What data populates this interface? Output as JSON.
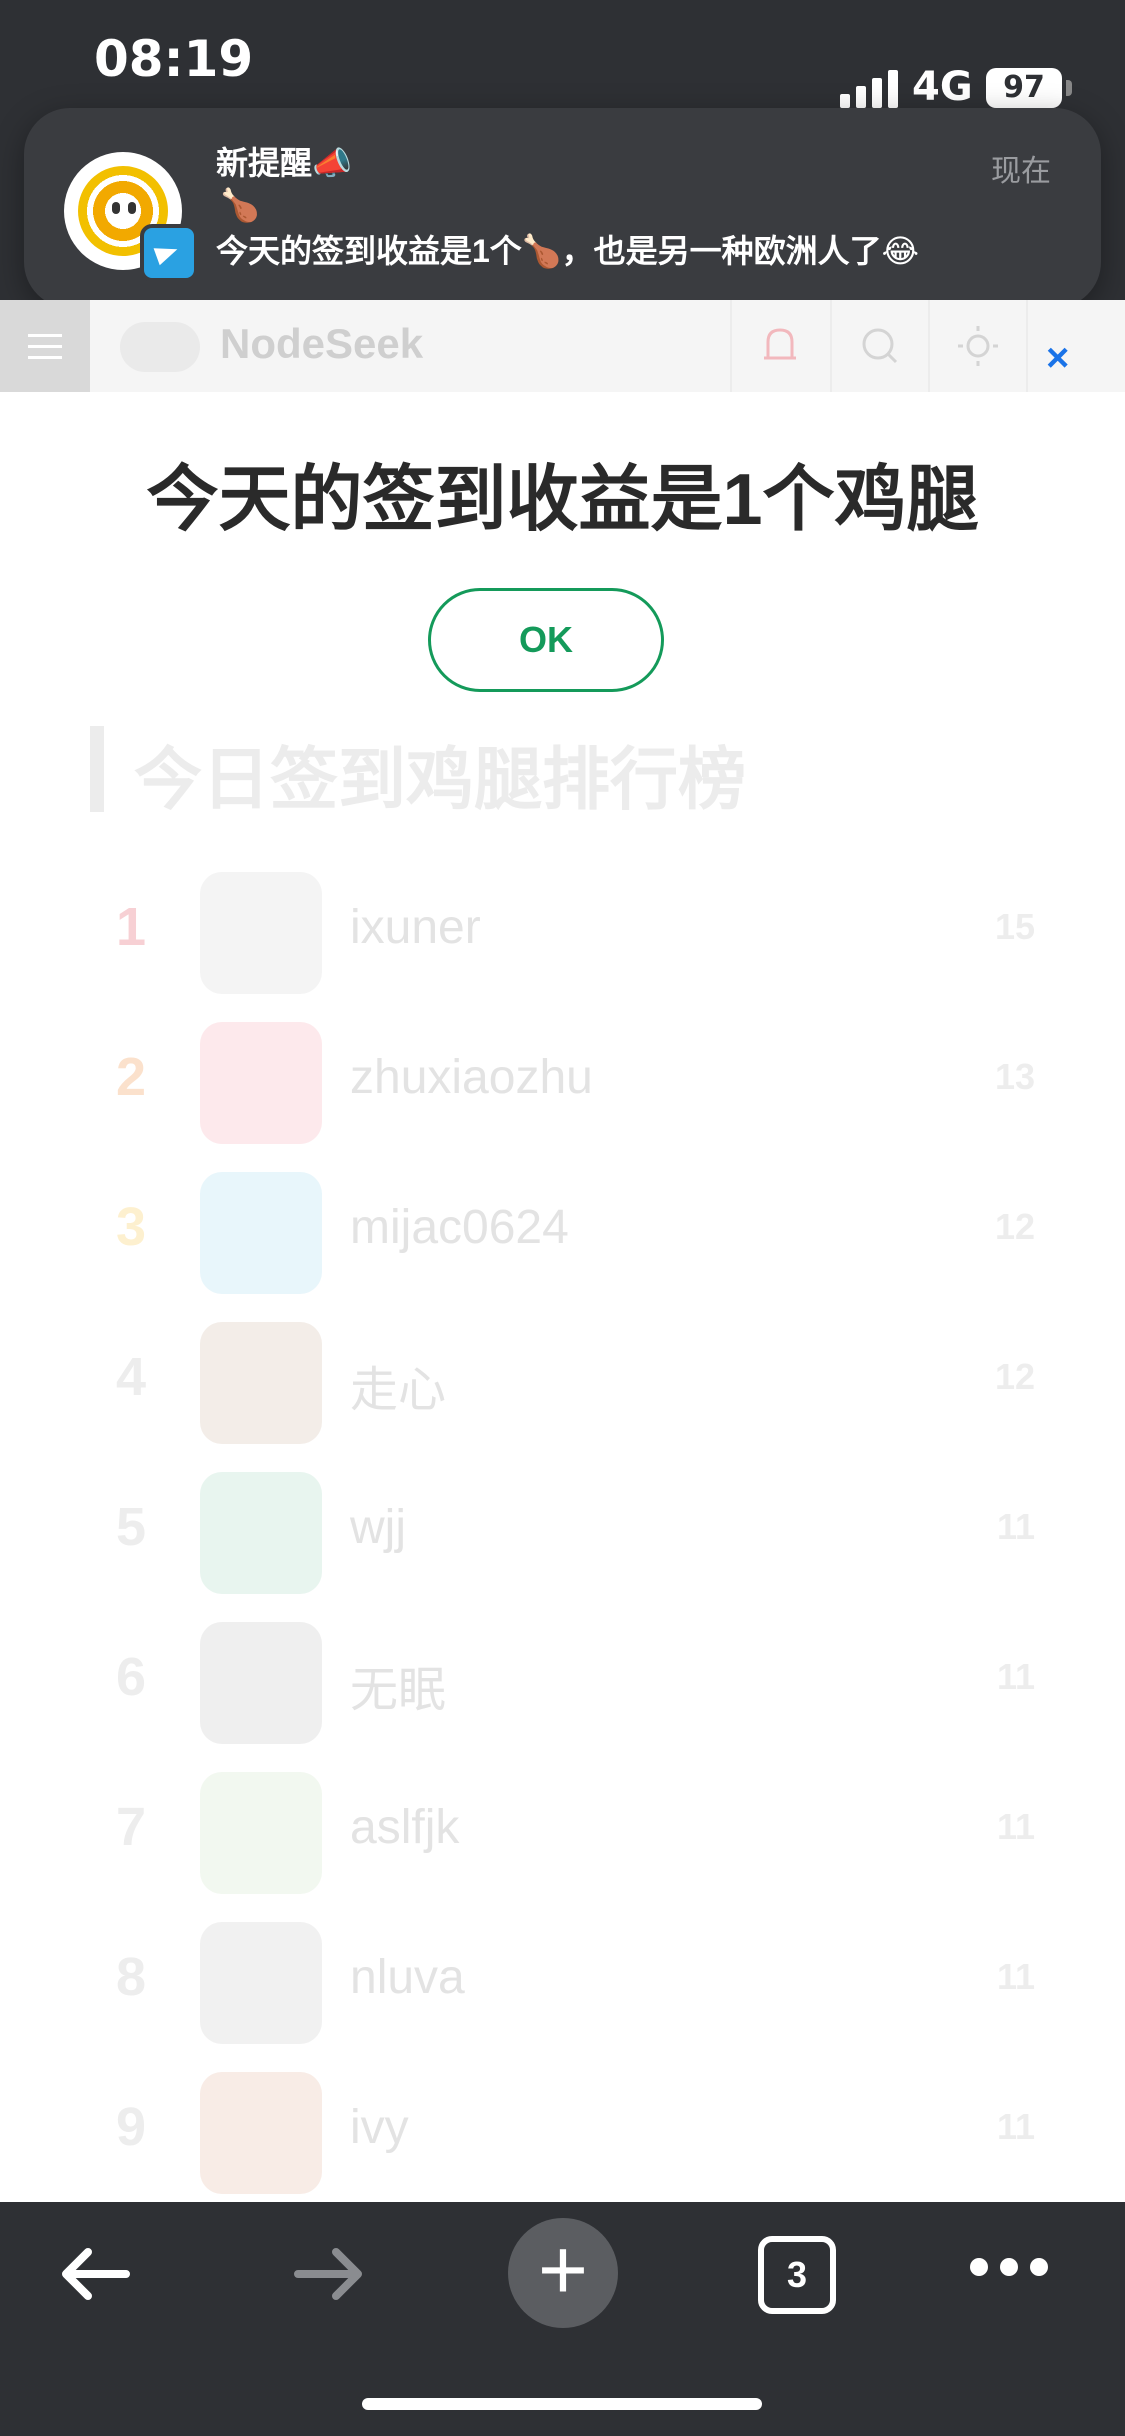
{
  "status_bar": {
    "time": "08:19",
    "network": "4G",
    "battery": "97"
  },
  "notification": {
    "title": "新提醒📣",
    "time": "现在",
    "line1": "🍗",
    "message": "今天的签到收益是1个🍗，也是另一种欧洲人了😂",
    "app": "Telegram"
  },
  "nav": {
    "brand": "NodeSeek"
  },
  "modal": {
    "title": "今天的签到收益是1个鸡腿",
    "ok_label": "OK",
    "close": "×"
  },
  "ranking": {
    "title": "今日签到鸡腿排行榜",
    "rows": [
      {
        "rank": "1",
        "name": "ixuner",
        "score": "15",
        "color": "#f7d0d4"
      },
      {
        "rank": "2",
        "name": "zhuxiaozhu",
        "score": "13",
        "color": "#fbe1cc"
      },
      {
        "rank": "3",
        "name": "mijac0624",
        "score": "12",
        "color": "#fdf0cf"
      },
      {
        "rank": "4",
        "name": "走心",
        "score": "12"
      },
      {
        "rank": "5",
        "name": "wjj",
        "score": "11"
      },
      {
        "rank": "6",
        "name": "无眠",
        "score": "11"
      },
      {
        "rank": "7",
        "name": "aslfjk",
        "score": "11"
      },
      {
        "rank": "8",
        "name": "nluva",
        "score": "11"
      },
      {
        "rank": "9",
        "name": "ivy",
        "score": "11"
      }
    ]
  },
  "browser_bar": {
    "tab_count": "3"
  }
}
